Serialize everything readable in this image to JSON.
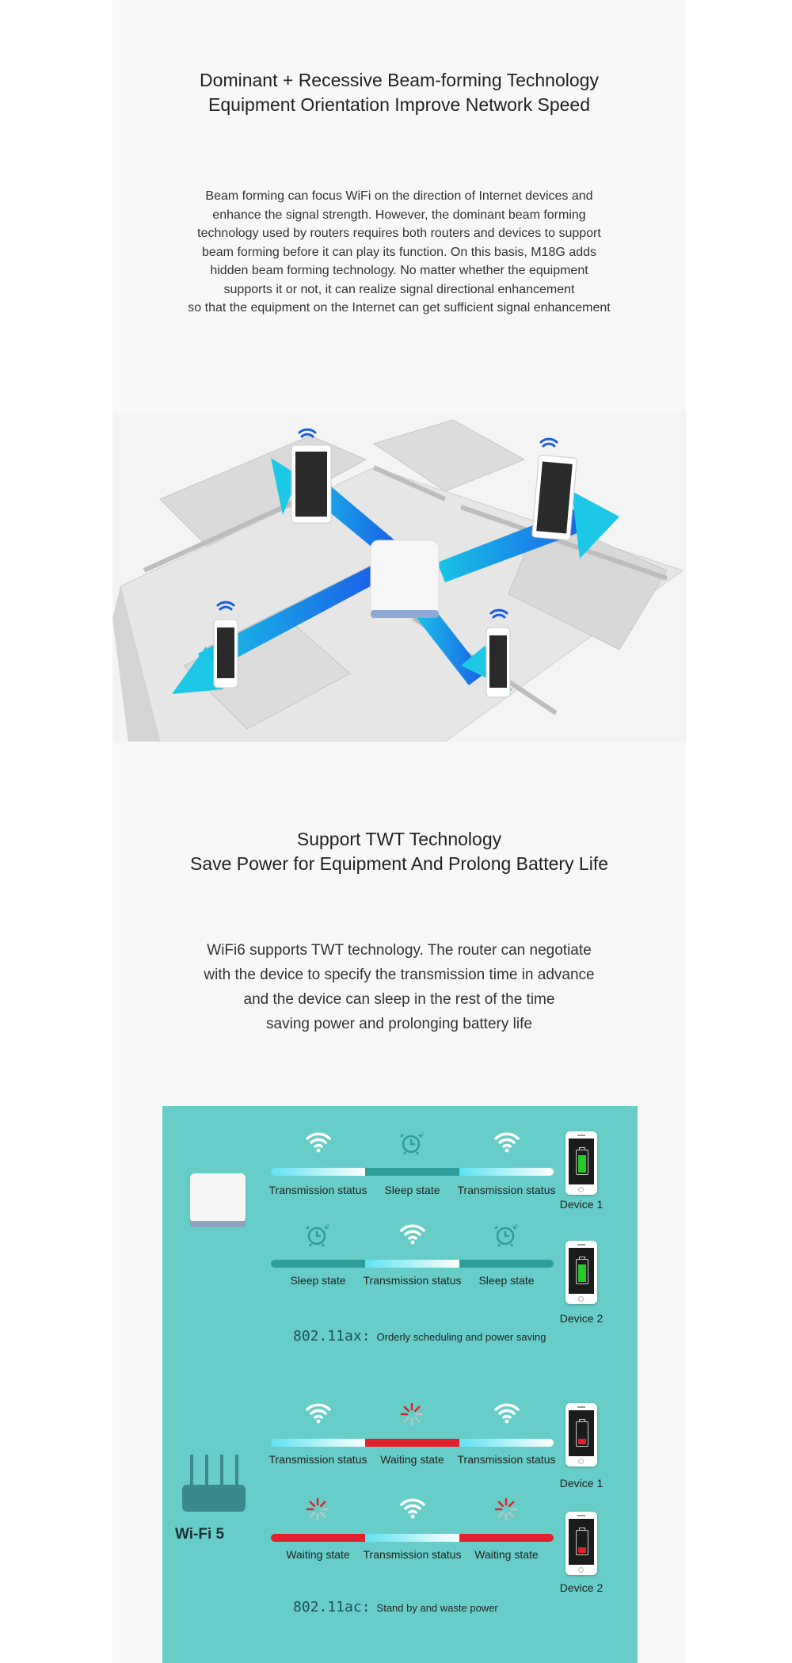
{
  "section1": {
    "title_lines": [
      "Dominant + Recessive Beam-forming Technology",
      "Equipment Orientation Improve Network Speed"
    ],
    "paragraph_lines": [
      "Beam forming can focus WiFi on the direction of Internet devices and",
      "enhance the signal strength. However, the dominant beam forming",
      "technology used by routers requires both routers and devices to support",
      "beam forming before it can play its function. On this basis, M18G adds",
      "hidden beam forming technology. No matter whether the equipment",
      "supports it or not, it can realize signal directional enhancement",
      "so that the equipment on the Internet can get sufficient signal enhancement"
    ],
    "illustration": "beamforming-floorplan-illustration"
  },
  "section2": {
    "title_lines": [
      "Support TWT Technology",
      "Save Power for Equipment And Prolong Battery Life"
    ],
    "paragraph_lines": [
      "WiFi6 supports TWT technology. The router can negotiate",
      "with the device to specify the transmission time in advance",
      "and the device can sleep in the rest of the time",
      "saving power and prolonging battery life"
    ]
  },
  "diagram": {
    "colors": {
      "panel": "#67cdc9",
      "transmission": "#5fe3ef",
      "sleep": "#2d9e9a",
      "waiting": "#e0202a",
      "battery_full": "#22cc22",
      "battery_low": "#e0202a"
    },
    "wifi6": {
      "rows": [
        {
          "device": "Device 1",
          "battery": "full",
          "segments": [
            {
              "state": "tx",
              "icon": "wifi-icon",
              "label": "Transmission status"
            },
            {
              "state": "sl",
              "icon": "alarm-clock-icon",
              "label": "Sleep state"
            },
            {
              "state": "tx",
              "icon": "wifi-icon",
              "label": "Transmission status"
            }
          ]
        },
        {
          "device": "Device 2",
          "battery": "full",
          "segments": [
            {
              "state": "sl",
              "icon": "alarm-clock-icon",
              "label": "Sleep state"
            },
            {
              "state": "tx",
              "icon": "wifi-icon",
              "label": "Transmission status"
            },
            {
              "state": "sl",
              "icon": "alarm-clock-icon",
              "label": "Sleep state"
            }
          ]
        }
      ],
      "standard": "802.11ax:",
      "description": "Orderly scheduling and power saving"
    },
    "wifi5": {
      "router_label": "Wi-Fi 5",
      "rows": [
        {
          "device": "Device 1",
          "battery": "low",
          "segments": [
            {
              "state": "tx",
              "icon": "wifi-icon",
              "label": "Transmission status"
            },
            {
              "state": "wt",
              "icon": "loading-spinner-icon",
              "label": "Waiting state"
            },
            {
              "state": "tx",
              "icon": "wifi-icon",
              "label": "Transmission status"
            }
          ]
        },
        {
          "device": "Device 2",
          "battery": "low",
          "segments": [
            {
              "state": "wt",
              "icon": "loading-spinner-icon",
              "label": "Waiting state"
            },
            {
              "state": "tx",
              "icon": "wifi-icon",
              "label": "Transmission status"
            },
            {
              "state": "wt",
              "icon": "loading-spinner-icon",
              "label": "Waiting state"
            }
          ]
        }
      ],
      "standard": "802.11ac:",
      "description": "Stand by and waste power"
    }
  }
}
